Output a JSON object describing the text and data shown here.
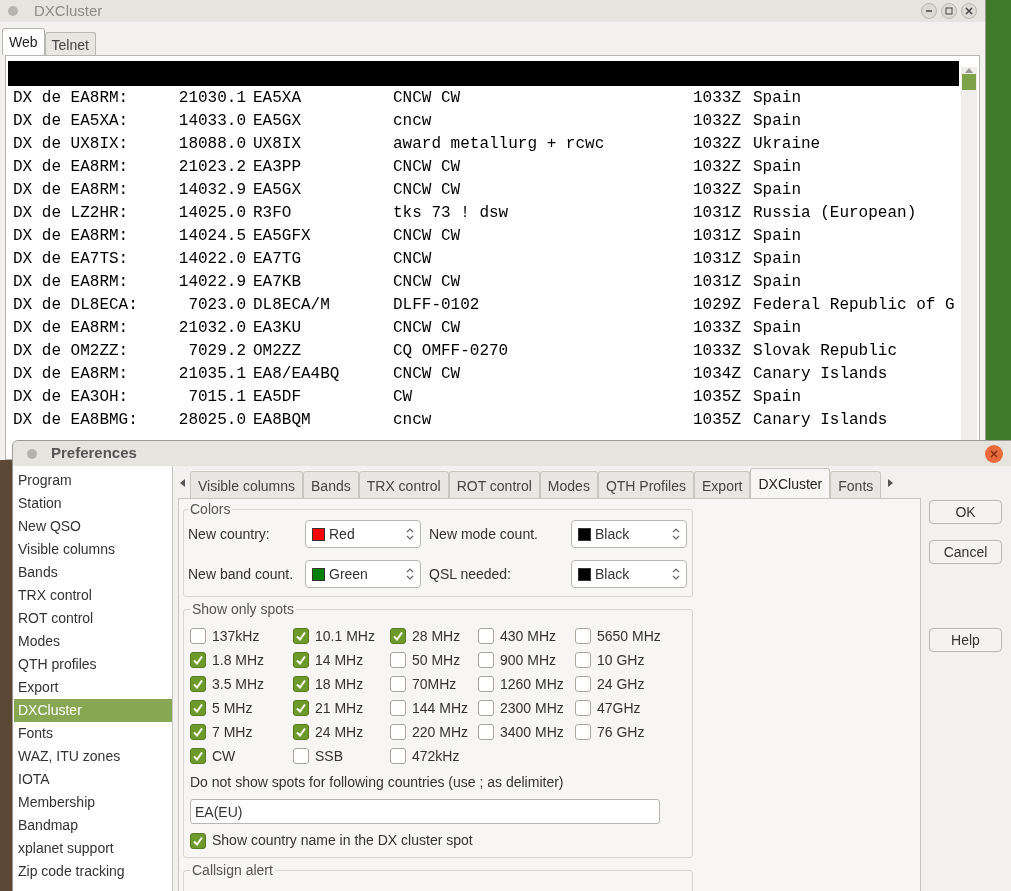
{
  "dx_window": {
    "title": "DXCluster",
    "tabs": [
      {
        "label": "Web",
        "selected": true
      },
      {
        "label": "Telnet",
        "selected": false
      }
    ],
    "spots": [
      {
        "spotter": "DX de EA8RM:",
        "frequency": "21030.1",
        "dx_call": "EA5XA",
        "comment": "CNCW CW",
        "time": "1033Z",
        "country": "Spain"
      },
      {
        "spotter": "DX de EA5XA:",
        "frequency": "14033.0",
        "dx_call": "EA5GX",
        "comment": "cncw",
        "time": "1032Z",
        "country": "Spain"
      },
      {
        "spotter": "DX de UX8IX:",
        "frequency": "18088.0",
        "dx_call": "UX8IX",
        "comment": "award metallurg + rcwc",
        "time": "1032Z",
        "country": "Ukraine"
      },
      {
        "spotter": "DX de EA8RM:",
        "frequency": "21023.2",
        "dx_call": "EA3PP",
        "comment": "CNCW CW",
        "time": "1032Z",
        "country": "Spain"
      },
      {
        "spotter": "DX de EA8RM:",
        "frequency": "14032.9",
        "dx_call": "EA5GX",
        "comment": "CNCW CW",
        "time": "1032Z",
        "country": "Spain"
      },
      {
        "spotter": "DX de LZ2HR:",
        "frequency": "14025.0",
        "dx_call": "R3FO",
        "comment": "tks 73 ! dsw",
        "time": "1031Z",
        "country": "Russia (European)"
      },
      {
        "spotter": "DX de EA8RM:",
        "frequency": "14024.5",
        "dx_call": "EA5GFX",
        "comment": "CNCW CW",
        "time": "1031Z",
        "country": "Spain"
      },
      {
        "spotter": "DX de EA7TS:",
        "frequency": "14022.0",
        "dx_call": "EA7TG",
        "comment": "CNCW",
        "time": "1031Z",
        "country": "Spain"
      },
      {
        "spotter": "DX de EA8RM:",
        "frequency": "14022.9",
        "dx_call": "EA7KB",
        "comment": "CNCW CW",
        "time": "1031Z",
        "country": "Spain"
      },
      {
        "spotter": "DX de DL8ECA:",
        "frequency": "7023.0",
        "dx_call": "DL8ECA/M",
        "comment": "DLFF-0102",
        "time": "1029Z",
        "country": "Federal Republic of G"
      },
      {
        "spotter": "DX de EA8RM:",
        "frequency": "21032.0",
        "dx_call": "EA3KU",
        "comment": "CNCW CW",
        "time": "1033Z",
        "country": "Spain"
      },
      {
        "spotter": "DX de OM2ZZ:",
        "frequency": "7029.2",
        "dx_call": "OM2ZZ",
        "comment": "CQ OMFF-0270",
        "time": "1033Z",
        "country": "Slovak Republic"
      },
      {
        "spotter": "DX de EA8RM:",
        "frequency": "21035.1",
        "dx_call": "EA8/EA4BQ",
        "comment": "CNCW CW",
        "time": "1034Z",
        "country": "Canary Islands"
      },
      {
        "spotter": "DX de EA3OH:",
        "frequency": "7015.1",
        "dx_call": "EA5DF",
        "comment": "CW",
        "time": "1035Z",
        "country": "Spain"
      },
      {
        "spotter": "DX de EA8BMG:",
        "frequency": "28025.0",
        "dx_call": "EA8BQM",
        "comment": "cncw",
        "time": "1035Z",
        "country": "Canary Islands"
      }
    ]
  },
  "preferences": {
    "title": "Preferences",
    "sidebar": [
      {
        "label": "Program",
        "selected": false
      },
      {
        "label": "Station",
        "selected": false
      },
      {
        "label": "New QSO",
        "selected": false
      },
      {
        "label": "Visible columns",
        "selected": false
      },
      {
        "label": "Bands",
        "selected": false
      },
      {
        "label": "TRX control",
        "selected": false
      },
      {
        "label": "ROT control",
        "selected": false
      },
      {
        "label": "Modes",
        "selected": false
      },
      {
        "label": "QTH profiles",
        "selected": false
      },
      {
        "label": "Export",
        "selected": false
      },
      {
        "label": "DXCluster",
        "selected": true
      },
      {
        "label": "Fonts",
        "selected": false
      },
      {
        "label": "WAZ, ITU zones",
        "selected": false
      },
      {
        "label": "IOTA",
        "selected": false
      },
      {
        "label": "Membership",
        "selected": false
      },
      {
        "label": "Bandmap",
        "selected": false
      },
      {
        "label": "xplanet support",
        "selected": false
      },
      {
        "label": "Zip code tracking",
        "selected": false
      }
    ],
    "tabs": [
      {
        "label": "Visible columns",
        "selected": false
      },
      {
        "label": "Bands",
        "selected": false
      },
      {
        "label": "TRX control",
        "selected": false
      },
      {
        "label": "ROT control",
        "selected": false
      },
      {
        "label": "Modes",
        "selected": false
      },
      {
        "label": "QTH Profiles",
        "selected": false
      },
      {
        "label": "Export",
        "selected": false
      },
      {
        "label": "DXCluster",
        "selected": true
      },
      {
        "label": "Fonts",
        "selected": false
      }
    ],
    "colors": {
      "title": "Colors",
      "fields": [
        {
          "label": "New country:",
          "value": "Red",
          "color": "#ff0000"
        },
        {
          "label": "New mode count.",
          "value": "Black",
          "color": "#000000"
        },
        {
          "label": "New band count.",
          "value": "Green",
          "color": "#008000"
        },
        {
          "label": "QSL needed:",
          "value": "Black",
          "color": "#000000"
        }
      ]
    },
    "show_only_spots": {
      "title": "Show only spots",
      "options": [
        {
          "label": "137kHz",
          "checked": false
        },
        {
          "label": "10.1 MHz",
          "checked": true
        },
        {
          "label": "28 MHz",
          "checked": true
        },
        {
          "label": "430 MHz",
          "checked": false
        },
        {
          "label": "5650 MHz",
          "checked": false
        },
        {
          "label": "1.8 MHz",
          "checked": true
        },
        {
          "label": "14 MHz",
          "checked": true
        },
        {
          "label": "50 MHz",
          "checked": false
        },
        {
          "label": "900 MHz",
          "checked": false
        },
        {
          "label": "10 GHz",
          "checked": false
        },
        {
          "label": "3.5 MHz",
          "checked": true
        },
        {
          "label": "18 MHz",
          "checked": true
        },
        {
          "label": "70MHz",
          "checked": false
        },
        {
          "label": "1260 MHz",
          "checked": false
        },
        {
          "label": "24 GHz",
          "checked": false
        },
        {
          "label": "5 MHz",
          "checked": true
        },
        {
          "label": "21 MHz",
          "checked": true
        },
        {
          "label": "144 MHz",
          "checked": false
        },
        {
          "label": "2300 MHz",
          "checked": false
        },
        {
          "label": "47GHz",
          "checked": false
        },
        {
          "label": "7 MHz",
          "checked": true
        },
        {
          "label": "24 MHz",
          "checked": true
        },
        {
          "label": "220 MHz",
          "checked": false
        },
        {
          "label": "3400 MHz",
          "checked": false
        },
        {
          "label": "76 GHz",
          "checked": false
        },
        {
          "label": "CW",
          "checked": true
        },
        {
          "label": "SSB",
          "checked": false
        },
        {
          "label": "472kHz",
          "checked": false
        }
      ],
      "exclude_label": "Do not show spots for following countries (use ; as delimiter)",
      "exclude_value": "EA(EU)",
      "show_country": {
        "label": "Show country name in the DX cluster spot",
        "checked": true
      }
    },
    "callsign_alert": {
      "title": "Callsign alert"
    },
    "buttons": [
      "OK",
      "Cancel",
      "Help"
    ]
  }
}
